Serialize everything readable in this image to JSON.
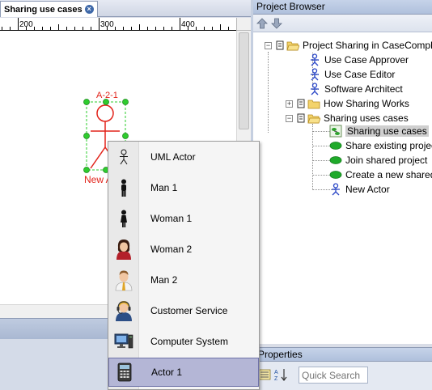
{
  "document_tab": {
    "label": "Sharing use cases",
    "close_glyph": "×"
  },
  "ruler": {
    "ticks": [
      "200",
      "300",
      "400"
    ]
  },
  "diagram": {
    "actor_id": "A-2-1",
    "actor_name": "New A"
  },
  "project_browser": {
    "title": "Project Browser",
    "tree": [
      {
        "label": "Project Sharing in CaseComple",
        "icon": "open-folder-icon"
      },
      {
        "label": "Use Case Approver",
        "icon": "actor-stick-icon"
      },
      {
        "label": "Use Case Editor",
        "icon": "actor-stick-icon"
      },
      {
        "label": "Software Architect",
        "icon": "actor-stick-icon"
      },
      {
        "label": "How Sharing Works",
        "icon": "folder-icon"
      },
      {
        "label": "Sharing uses cases",
        "icon": "open-folder-icon"
      },
      {
        "label": "Sharing use cases",
        "icon": "diagram-icon"
      },
      {
        "label": "Share existing project",
        "icon": "use-case-icon"
      },
      {
        "label": "Join shared project",
        "icon": "use-case-icon"
      },
      {
        "label": "Create a new shared",
        "icon": "use-case-icon"
      },
      {
        "label": "New Actor",
        "icon": "actor-stick-icon"
      }
    ]
  },
  "properties": {
    "title": "Properties",
    "search_placeholder": "Quick Search"
  },
  "actor_menu": {
    "items": [
      {
        "label": "UML Actor",
        "icon": "uml-actor-icon"
      },
      {
        "label": "Man 1",
        "icon": "man-silhouette-icon"
      },
      {
        "label": "Woman 1",
        "icon": "woman-silhouette-icon"
      },
      {
        "label": "Woman 2",
        "icon": "woman-avatar-icon"
      },
      {
        "label": "Man 2",
        "icon": "man-avatar-icon"
      },
      {
        "label": "Customer Service",
        "icon": "customer-service-icon"
      },
      {
        "label": "Computer System",
        "icon": "computer-icon"
      },
      {
        "label": "Actor 1",
        "icon": "phone-icon"
      }
    ],
    "active_index": 7
  },
  "colors": {
    "accent": "#3f69a9",
    "selection_red": "#e2231a",
    "handle_green": "#2ecc2e",
    "menu_highlight": "#b4b6d6"
  }
}
